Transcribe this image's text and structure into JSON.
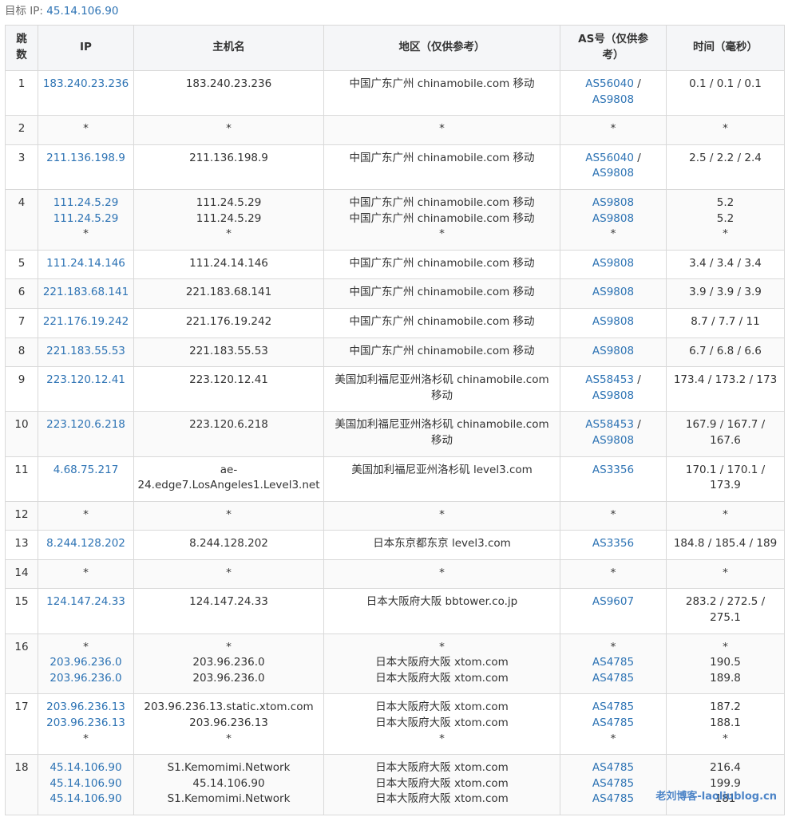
{
  "target": {
    "label": "目标 IP:",
    "ip": "45.14.106.90"
  },
  "columns": [
    "跳数",
    "IP",
    "主机名",
    "地区（仅供参考）",
    "AS号（仅供参考）",
    "时间（毫秒）"
  ],
  "hops": [
    {
      "hop": "1",
      "ips": [
        "183.240.23.236"
      ],
      "hosts": [
        "183.240.23.236"
      ],
      "regions": [
        "中国广东广州 chinamobile.com 移动"
      ],
      "as": [
        [
          "AS56040",
          "AS9808"
        ]
      ],
      "times": [
        "0.1 / 0.1 / 0.1"
      ]
    },
    {
      "hop": "2",
      "ips": [
        "*"
      ],
      "hosts": [
        "*"
      ],
      "regions": [
        "*"
      ],
      "as": [
        [
          "*"
        ]
      ],
      "times": [
        "*"
      ]
    },
    {
      "hop": "3",
      "ips": [
        "211.136.198.9"
      ],
      "hosts": [
        "211.136.198.9"
      ],
      "regions": [
        "中国广东广州 chinamobile.com 移动"
      ],
      "as": [
        [
          "AS56040",
          "AS9808"
        ]
      ],
      "times": [
        "2.5 / 2.2 / 2.4"
      ]
    },
    {
      "hop": "4",
      "ips": [
        "111.24.5.29",
        "111.24.5.29",
        "*"
      ],
      "hosts": [
        "111.24.5.29",
        "111.24.5.29",
        "*"
      ],
      "regions": [
        "中国广东广州 chinamobile.com 移动",
        "中国广东广州 chinamobile.com 移动",
        "*"
      ],
      "as": [
        [
          "AS9808"
        ],
        [
          "AS9808"
        ],
        [
          "*"
        ]
      ],
      "times": [
        "5.2",
        "5.2",
        "*"
      ]
    },
    {
      "hop": "5",
      "ips": [
        "111.24.14.146"
      ],
      "hosts": [
        "111.24.14.146"
      ],
      "regions": [
        "中国广东广州 chinamobile.com 移动"
      ],
      "as": [
        [
          "AS9808"
        ]
      ],
      "times": [
        "3.4 / 3.4 / 3.4"
      ]
    },
    {
      "hop": "6",
      "ips": [
        "221.183.68.141"
      ],
      "hosts": [
        "221.183.68.141"
      ],
      "regions": [
        "中国广东广州 chinamobile.com 移动"
      ],
      "as": [
        [
          "AS9808"
        ]
      ],
      "times": [
        "3.9 / 3.9 / 3.9"
      ]
    },
    {
      "hop": "7",
      "ips": [
        "221.176.19.242"
      ],
      "hosts": [
        "221.176.19.242"
      ],
      "regions": [
        "中国广东广州 chinamobile.com 移动"
      ],
      "as": [
        [
          "AS9808"
        ]
      ],
      "times": [
        "8.7 / 7.7 / 11"
      ]
    },
    {
      "hop": "8",
      "ips": [
        "221.183.55.53"
      ],
      "hosts": [
        "221.183.55.53"
      ],
      "regions": [
        "中国广东广州 chinamobile.com 移动"
      ],
      "as": [
        [
          "AS9808"
        ]
      ],
      "times": [
        "6.7 / 6.8 / 6.6"
      ]
    },
    {
      "hop": "9",
      "ips": [
        "223.120.12.41"
      ],
      "hosts": [
        "223.120.12.41"
      ],
      "regions": [
        "美国加利福尼亚州洛杉矶 chinamobile.com 移动"
      ],
      "as": [
        [
          "AS58453",
          "AS9808"
        ]
      ],
      "times": [
        "173.4 / 173.2 / 173"
      ]
    },
    {
      "hop": "10",
      "ips": [
        "223.120.6.218"
      ],
      "hosts": [
        "223.120.6.218"
      ],
      "regions": [
        "美国加利福尼亚州洛杉矶 chinamobile.com 移动"
      ],
      "as": [
        [
          "AS58453",
          "AS9808"
        ]
      ],
      "times": [
        "167.9 / 167.7 / 167.6"
      ]
    },
    {
      "hop": "11",
      "ips": [
        "4.68.75.217"
      ],
      "hosts": [
        "ae-24.edge7.LosAngeles1.Level3.net"
      ],
      "regions": [
        "美国加利福尼亚州洛杉矶 level3.com"
      ],
      "as": [
        [
          "AS3356"
        ]
      ],
      "times": [
        "170.1 / 170.1 / 173.9"
      ]
    },
    {
      "hop": "12",
      "ips": [
        "*"
      ],
      "hosts": [
        "*"
      ],
      "regions": [
        "*"
      ],
      "as": [
        [
          "*"
        ]
      ],
      "times": [
        "*"
      ]
    },
    {
      "hop": "13",
      "ips": [
        "8.244.128.202"
      ],
      "hosts": [
        "8.244.128.202"
      ],
      "regions": [
        "日本东京都东京 level3.com"
      ],
      "as": [
        [
          "AS3356"
        ]
      ],
      "times": [
        "184.8 / 185.4 / 189"
      ]
    },
    {
      "hop": "14",
      "ips": [
        "*"
      ],
      "hosts": [
        "*"
      ],
      "regions": [
        "*"
      ],
      "as": [
        [
          "*"
        ]
      ],
      "times": [
        "*"
      ]
    },
    {
      "hop": "15",
      "ips": [
        "124.147.24.33"
      ],
      "hosts": [
        "124.147.24.33"
      ],
      "regions": [
        "日本大阪府大阪 bbtower.co.jp"
      ],
      "as": [
        [
          "AS9607"
        ]
      ],
      "times": [
        "283.2 / 272.5 / 275.1"
      ]
    },
    {
      "hop": "16",
      "ips": [
        "*",
        "203.96.236.0",
        "203.96.236.0"
      ],
      "hosts": [
        "*",
        "203.96.236.0",
        "203.96.236.0"
      ],
      "regions": [
        "*",
        "日本大阪府大阪 xtom.com",
        "日本大阪府大阪 xtom.com"
      ],
      "as": [
        [
          "*"
        ],
        [
          "AS4785"
        ],
        [
          "AS4785"
        ]
      ],
      "times": [
        "*",
        "190.5",
        "189.8"
      ]
    },
    {
      "hop": "17",
      "ips": [
        "203.96.236.13",
        "203.96.236.13",
        "*"
      ],
      "hosts": [
        "203.96.236.13.static.xtom.com",
        "203.96.236.13",
        "*"
      ],
      "regions": [
        "日本大阪府大阪 xtom.com",
        "日本大阪府大阪 xtom.com",
        "*"
      ],
      "as": [
        [
          "AS4785"
        ],
        [
          "AS4785"
        ],
        [
          "*"
        ]
      ],
      "times": [
        "187.2",
        "188.1",
        "*"
      ]
    },
    {
      "hop": "18",
      "ips": [
        "45.14.106.90",
        "45.14.106.90",
        "45.14.106.90"
      ],
      "hosts": [
        "S1.Kemomimi.Network",
        "45.14.106.90",
        "S1.Kemomimi.Network"
      ],
      "regions": [
        "日本大阪府大阪 xtom.com",
        "日本大阪府大阪 xtom.com",
        "日本大阪府大阪 xtom.com"
      ],
      "as": [
        [
          "AS4785"
        ],
        [
          "AS4785"
        ],
        [
          "AS4785"
        ]
      ],
      "times": [
        "216.4",
        "199.9",
        "181"
      ]
    }
  ],
  "watermark": "老刘博客-laoliublog.cn"
}
